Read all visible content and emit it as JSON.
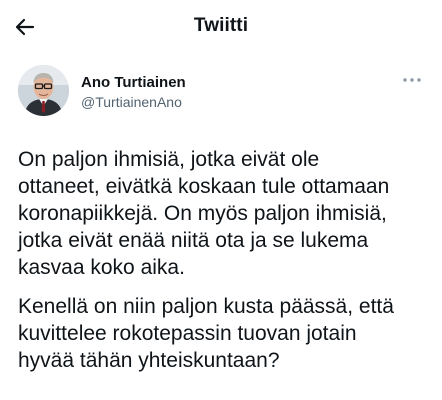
{
  "header": {
    "title": "Twiitti",
    "back_icon": "arrow-left-icon"
  },
  "tweet": {
    "author": {
      "name": "Ano Turtiainen",
      "handle": "@TurtiainenAno",
      "avatar_icon": "profile-photo"
    },
    "more_icon": "more-horizontal-icon",
    "paragraphs": [
      "On paljon ihmisiä, jotka eivät ole\nottaneet, eivätkä koskaan tule ottamaan\nkoronapiikkejä. On myös paljon ihmisiä,\njotka eivät enää niitä ota ja se lukema\nkasvaa koko aika.",
      "Kenellä on niin paljon kusta päässä, että\nkuvittelee rokotepassin tuovan jotain\nhyvää tähän yhteiskuntaan?"
    ]
  },
  "colors": {
    "text": "#0f1419",
    "secondary_text": "#536471",
    "background": "#ffffff"
  }
}
